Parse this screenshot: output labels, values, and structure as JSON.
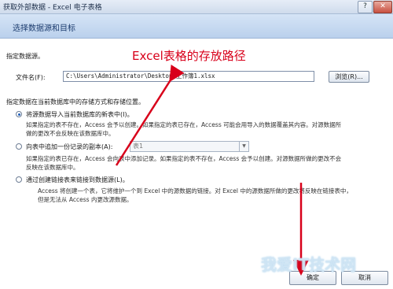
{
  "window": {
    "title": "获取外部数据 - Excel 电子表格",
    "help": "?",
    "close": "✕"
  },
  "header": {
    "title": "选择数据源和目标"
  },
  "annotation": {
    "text": "Excel表格的存放路径"
  },
  "source": {
    "label": "指定数据源。",
    "filename_label": "文件名(F):",
    "filename_value": "C:\\Users\\Administrator\\Desktop\\工作簿1.xlsx",
    "browse": "浏览(R)..."
  },
  "storage": {
    "label": "指定数据在当前数据库中的存储方式和存储位置。",
    "options": [
      {
        "label": "将源数据导入当前数据库的新表中(I)。",
        "desc1": "如果指定的表不存在，Access 会予以创建。如果指定的表已存在，Access 可能会用导入的数据覆盖其内容。对源数据所",
        "desc2": "做的更改不会反映在该数据库中。"
      },
      {
        "label": "向表中追加一份记录的副本(A):",
        "select": "表1",
        "desc1": "如果指定的表已存在，Access 会向表中添加记录。如果指定的表不存在，Access 会予以创建。对源数据所做的更改不会",
        "desc2": "反映在该数据库中。"
      },
      {
        "label": "通过创建链接表来链接到数据源(L)。",
        "desc1": "Access 将创建一个表，它将维护一个到 Excel 中的源数据的链接。对 Excel 中的源数据所做的更改将反映在链接表中，",
        "desc2": "但是无法从 Access 内更改源数据。"
      }
    ]
  },
  "buttons": {
    "ok": "确定",
    "cancel": "取消"
  },
  "watermark": {
    "text": "我爱IT技术网"
  },
  "colors": {
    "annotation": "#d8001a",
    "header_bg": "#c7daf1",
    "arrow": "#d8001a"
  }
}
